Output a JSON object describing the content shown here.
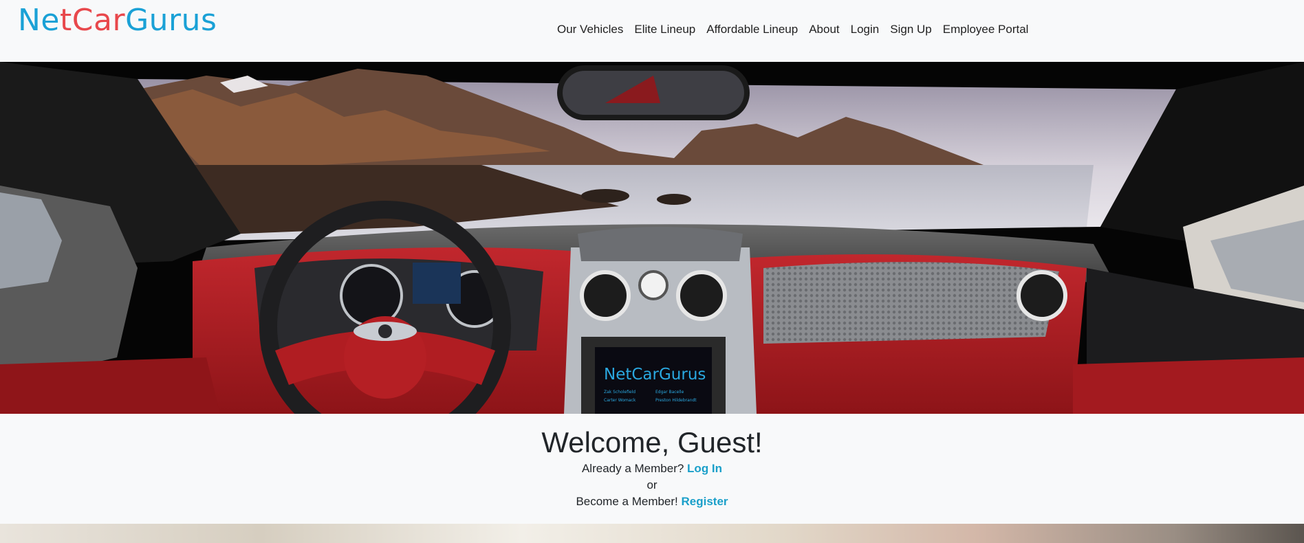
{
  "brand": {
    "part1": "N",
    "part2": "e",
    "part3": "t",
    "part4": "C",
    "part5": "a",
    "part6": "r",
    "part7": "G",
    "part8": "urus",
    "colors": {
      "blue": "#1aa1d6",
      "red": "#e8484c"
    }
  },
  "nav": {
    "items": [
      {
        "label": "Our Vehicles"
      },
      {
        "label": "Elite Lineup"
      },
      {
        "label": "Affordable Lineup"
      },
      {
        "label": "About"
      },
      {
        "label": "Login"
      },
      {
        "label": "Sign Up"
      },
      {
        "label": "Employee Portal"
      }
    ]
  },
  "hero": {
    "screen_brand": "NetCarGurus",
    "screen_credits": [
      "Zak Scholefield",
      "Edgar Bacelle",
      "Carter Womack",
      "Preston Hildebrandt"
    ]
  },
  "welcome": {
    "title": "Welcome, Guest!",
    "member_text": "Already a Member?",
    "login_link": "Log In",
    "or_text": "or",
    "become_text": "Become a Member!",
    "register_link": "Register"
  }
}
